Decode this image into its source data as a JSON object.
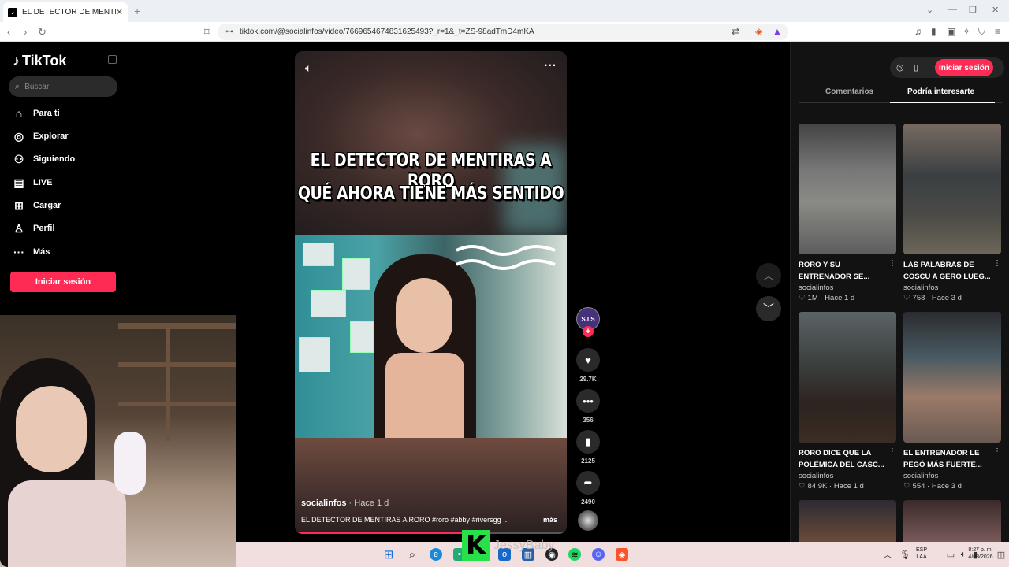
{
  "browser": {
    "tab_title": "EL DETECTOR DE MENTIRAS",
    "url": "tiktok.com/@socialinfos/video/7669654674831625493?_r=1&_t=ZS-98adTmD4mKA"
  },
  "sidebar": {
    "logo": "TikTok",
    "search_placeholder": "Buscar",
    "items": [
      {
        "label": "Para ti",
        "icon": "home-icon"
      },
      {
        "label": "Explorar",
        "icon": "compass-icon"
      },
      {
        "label": "Siguiendo",
        "icon": "following-icon"
      },
      {
        "label": "LIVE",
        "icon": "live-icon"
      },
      {
        "label": "Cargar",
        "icon": "upload-icon"
      },
      {
        "label": "Perfil",
        "icon": "profile-icon"
      },
      {
        "label": "Más",
        "icon": "more-icon"
      }
    ],
    "login": "Iniciar sesión"
  },
  "video": {
    "caption_line1": "EL DETECTOR DE MENTIRAS A RORO",
    "caption_line2": "QUÉ AHORA TIENE MÁS SENTIDO",
    "author": "socialinfos",
    "time": "· Hace 1 d",
    "description": "EL DETECTOR DE MENTIRAS A RORO #roro #abby #riversgg ...",
    "more": "más",
    "avatar_text": "S.I.S",
    "likes": "29.7K",
    "comments": "356",
    "saves": "2125",
    "shares": "2490",
    "progress_pct": 62
  },
  "right_panel": {
    "login": "Iniciar sesión",
    "tab_comments": "Comentarios",
    "tab_interest": "Podría interesarte",
    "cards": [
      {
        "title": "RORO Y SU ENTRENADOR SE...",
        "author": "socialinfos",
        "likes": "1M",
        "time": "Hace 1 d"
      },
      {
        "title": "LAS PALABRAS DE COSCU A GERO LUEG...",
        "author": "socialinfos",
        "likes": "758",
        "time": "Hace 3 d"
      },
      {
        "title": "RORO DICE QUE LA POLÉMICA DEL CASC...",
        "author": "socialinfos",
        "likes": "84.9K",
        "time": "Hace 1 d"
      },
      {
        "title": "EL ENTRENADOR LE PEGÓ MÁS FUERTE...",
        "author": "socialinfos",
        "likes": "554",
        "time": "Hace 3 d"
      }
    ]
  },
  "taskbar": {
    "overlay_text": "JessyBaby",
    "lang": "ESP",
    "lang2": "LAA",
    "time": "8:27 p. m.",
    "date": "4/08/2026"
  },
  "colors": {
    "accent": "#fe2c55",
    "k_logo": "#27e04a"
  }
}
